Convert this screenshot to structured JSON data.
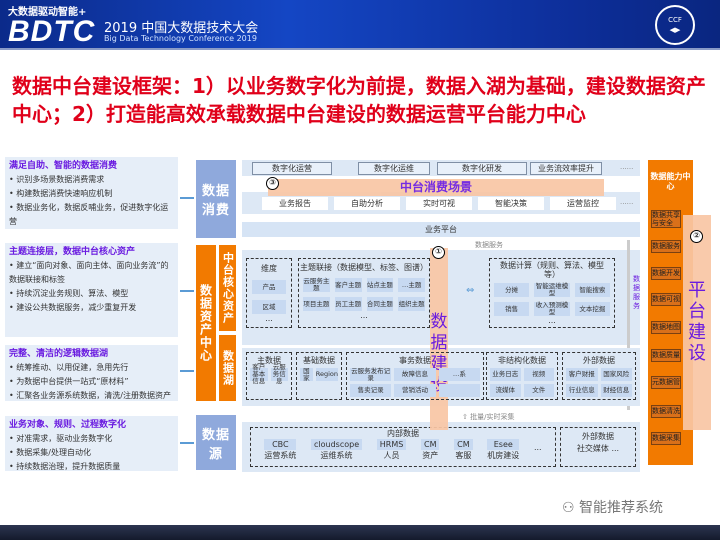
{
  "header": {
    "slogan": "大数据驱动智能+",
    "logo": "BDTC",
    "conference_cn": "2019 中国大数据技术大会",
    "conference_en": "Big Data Technology Conference 2019",
    "seal": "中国计算机学会 CCF"
  },
  "title": "数据中台建设框架：1）以业务数字化为前提，数据入湖为基础，建设数据资产中心；2）打造能高效承载数据中台建设的数据运营平台能力中心",
  "left_boxes": [
    {
      "heading": "满足自助、智能的数据消费",
      "bullets": [
        "识别多场景数据消费需求",
        "构建数据消费快速响应机制",
        "数据业务化，数据反哺业务，促进数字化运营"
      ]
    },
    {
      "heading": "主题连接层，数据中台核心资产",
      "bullets": [
        "建立“面向对象、面向主体、面向业务流”的数据联接和标签",
        "持续沉淀业务规则、算法、模型",
        "建设公共数据服务，减少重复开发"
      ]
    },
    {
      "heading": "完整、清洁的逻辑数据湖",
      "bullets": [
        "统筹推动、以用促建，急用先行",
        "为数据中台提供一站式“原材料”",
        "汇聚各业务源系统数据，清洗/注册数据资产"
      ]
    },
    {
      "heading": "业务对象、规则、过程数字化",
      "bullets": [
        "对准需求，驱动业务数字化",
        "数据采集/处理自动化",
        "持续数据治理，提升数据质量"
      ]
    }
  ],
  "layers": {
    "consume": "数据消费",
    "asset_center": "数据资产中心",
    "core_assets": "中台核心资产",
    "lake": "数据湖",
    "source": "数据源"
  },
  "top_buttons": [
    "数字化运营",
    "数字化运维",
    "数字化研发",
    "业务流效率提升",
    "......"
  ],
  "scene_label": "中台消费场景",
  "scene_items": [
    "业务报告",
    "自助分析",
    "实时可视",
    "智能决策",
    "运营监控",
    "......"
  ],
  "business_platform": "业务平台",
  "data_service": "数据服务",
  "data_service_vertical": "数据服务",
  "dimension": {
    "title": "维度",
    "items": [
      "产品",
      "区域",
      "..."
    ]
  },
  "topics": {
    "title": "主题联接（数据模型、标签、图谱）",
    "items": [
      "云服务主题",
      "客户主题",
      "站点主题",
      "…主题",
      "项目主题",
      "员工主题",
      "合同主题",
      "组织主题"
    ],
    "more": "..."
  },
  "compute": {
    "title": "数据计算（规则、算法、模型等）",
    "items": [
      "分摊",
      "智能运维模型",
      "智能搜索",
      "销售",
      "收入预测模型",
      "文本挖掘"
    ],
    "more": "..."
  },
  "lake_groups": [
    {
      "title": "主数据",
      "items": [
        "客户基本信息",
        "云服务信息"
      ]
    },
    {
      "title": "基础数据",
      "items": [
        "国家",
        "Region"
      ]
    },
    {
      "title": "事务数据",
      "items": [
        "云服务发布记录",
        "故障信息",
        "…系",
        "售卖记录",
        "营销活动",
        ""
      ]
    },
    {
      "title": "非结构化数据",
      "items": [
        "业务日志",
        "视频",
        "流媒体",
        "文件"
      ]
    },
    {
      "title": "外部数据",
      "items": [
        "客户财报",
        "国家风险",
        "行业信息",
        "财经信息"
      ]
    }
  ],
  "collect": "批量/实时采集",
  "internal": {
    "title": "内部数据",
    "systems": [
      {
        "name": "CBC",
        "desc": "运营系统"
      },
      {
        "name": "cloudscope",
        "desc": "运维系统"
      },
      {
        "name": "HRMS",
        "desc": "人员"
      },
      {
        "name": "CM",
        "desc": "资产"
      },
      {
        "name": "CM",
        "desc": "客服"
      },
      {
        "name": "Esee",
        "desc": "机房建设"
      }
    ],
    "more": "..."
  },
  "external": {
    "title": "外部数据",
    "desc": "社交媒体",
    "more": "..."
  },
  "capability": {
    "title": "数据能力中心",
    "items": [
      "数据共享与安全",
      "数据服务",
      "数据开发",
      "数据可视化",
      "数据地图",
      "数据质量",
      "元数据管理",
      "数据清洗",
      "数据采集"
    ]
  },
  "overlays": [
    {
      "num": "①",
      "label": "数据建设"
    },
    {
      "num": "②",
      "label": "平台建设"
    },
    {
      "num": "③",
      "label": "中台消费场景"
    }
  ],
  "watermark": "智能推荐系统"
}
